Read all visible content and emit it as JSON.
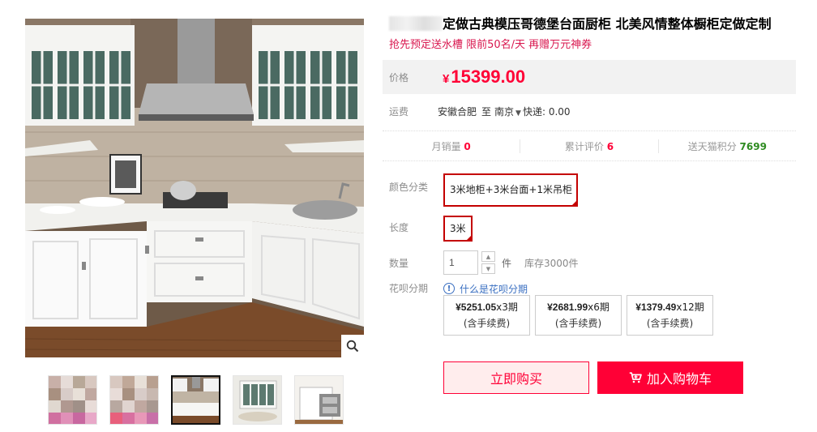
{
  "product": {
    "title": "定做古典模压哥德堡台面厨柜 北美风情整体橱柜定做定制",
    "promo": "抢先预定送水槽 限前50名/天 再赠万元神券"
  },
  "price": {
    "label": "价格",
    "currency": "¥",
    "value": "15399.00"
  },
  "shipping": {
    "label": "运费",
    "from": "安徽合肥",
    "to_prefix": "至",
    "to": "南京",
    "express": "快递: 0.00"
  },
  "stats": {
    "monthly_sales_label": "月销量",
    "monthly_sales": "0",
    "reviews_label": "累计评价",
    "reviews": "6",
    "points_label": "送天猫积分",
    "points": "7699"
  },
  "color": {
    "label": "颜色分类",
    "selected": "3米地柜+3米台面+1米吊柜"
  },
  "length": {
    "label": "长度",
    "selected": "3米"
  },
  "quantity": {
    "label": "数量",
    "value": "1",
    "unit": "件",
    "stock": "库存3000件"
  },
  "huabei": {
    "label": "花呗分期",
    "help": "什么是花呗分期",
    "plans": [
      {
        "amount": "¥5251.05",
        "periods": "x3期",
        "fee": "(含手续费)"
      },
      {
        "amount": "¥2681.99",
        "periods": "x6期",
        "fee": "(含手续费)"
      },
      {
        "amount": "¥1379.49",
        "periods": "x12期",
        "fee": "(含手续费)"
      }
    ]
  },
  "actions": {
    "buy_now": "立即购买",
    "add_cart": "加入购物车"
  },
  "colors": {
    "accent": "#ff0036",
    "select_border": "#c40000",
    "link": "#3a6fc1"
  }
}
